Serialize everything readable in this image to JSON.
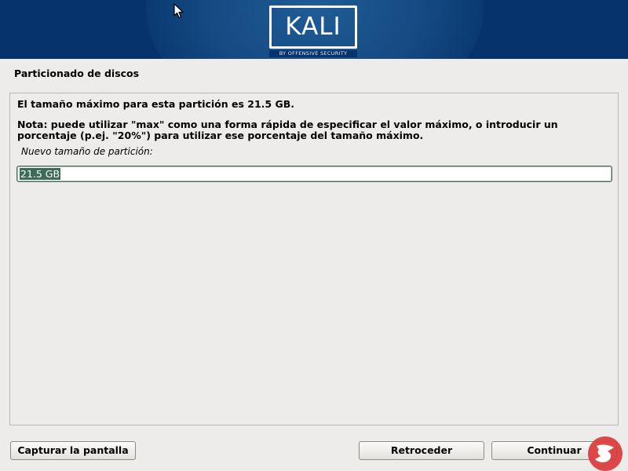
{
  "header": {
    "logo_text": "KALI",
    "logo_tagline": "BY OFFENSIVE SECURITY"
  },
  "page": {
    "title": "Particionado de discos"
  },
  "content": {
    "info": "El tamaño máximo para esta partición es 21.5 GB.",
    "note": "Nota: puede utilizar \"max\" como una forma rápida de especificar el valor máximo, o introducir un porcentaje (p.ej. \"20%\") para utilizar ese porcentaje del tamaño máximo.",
    "field_label": "Nuevo tamaño de partición:",
    "field_value": "21.5 GB"
  },
  "buttons": {
    "screenshot": "Capturar la pantalla",
    "back": "Retroceder",
    "continue": "Continuar"
  },
  "colors": {
    "banner": "#06336b",
    "background": "#edeceb",
    "selection": "#3e6b59"
  }
}
